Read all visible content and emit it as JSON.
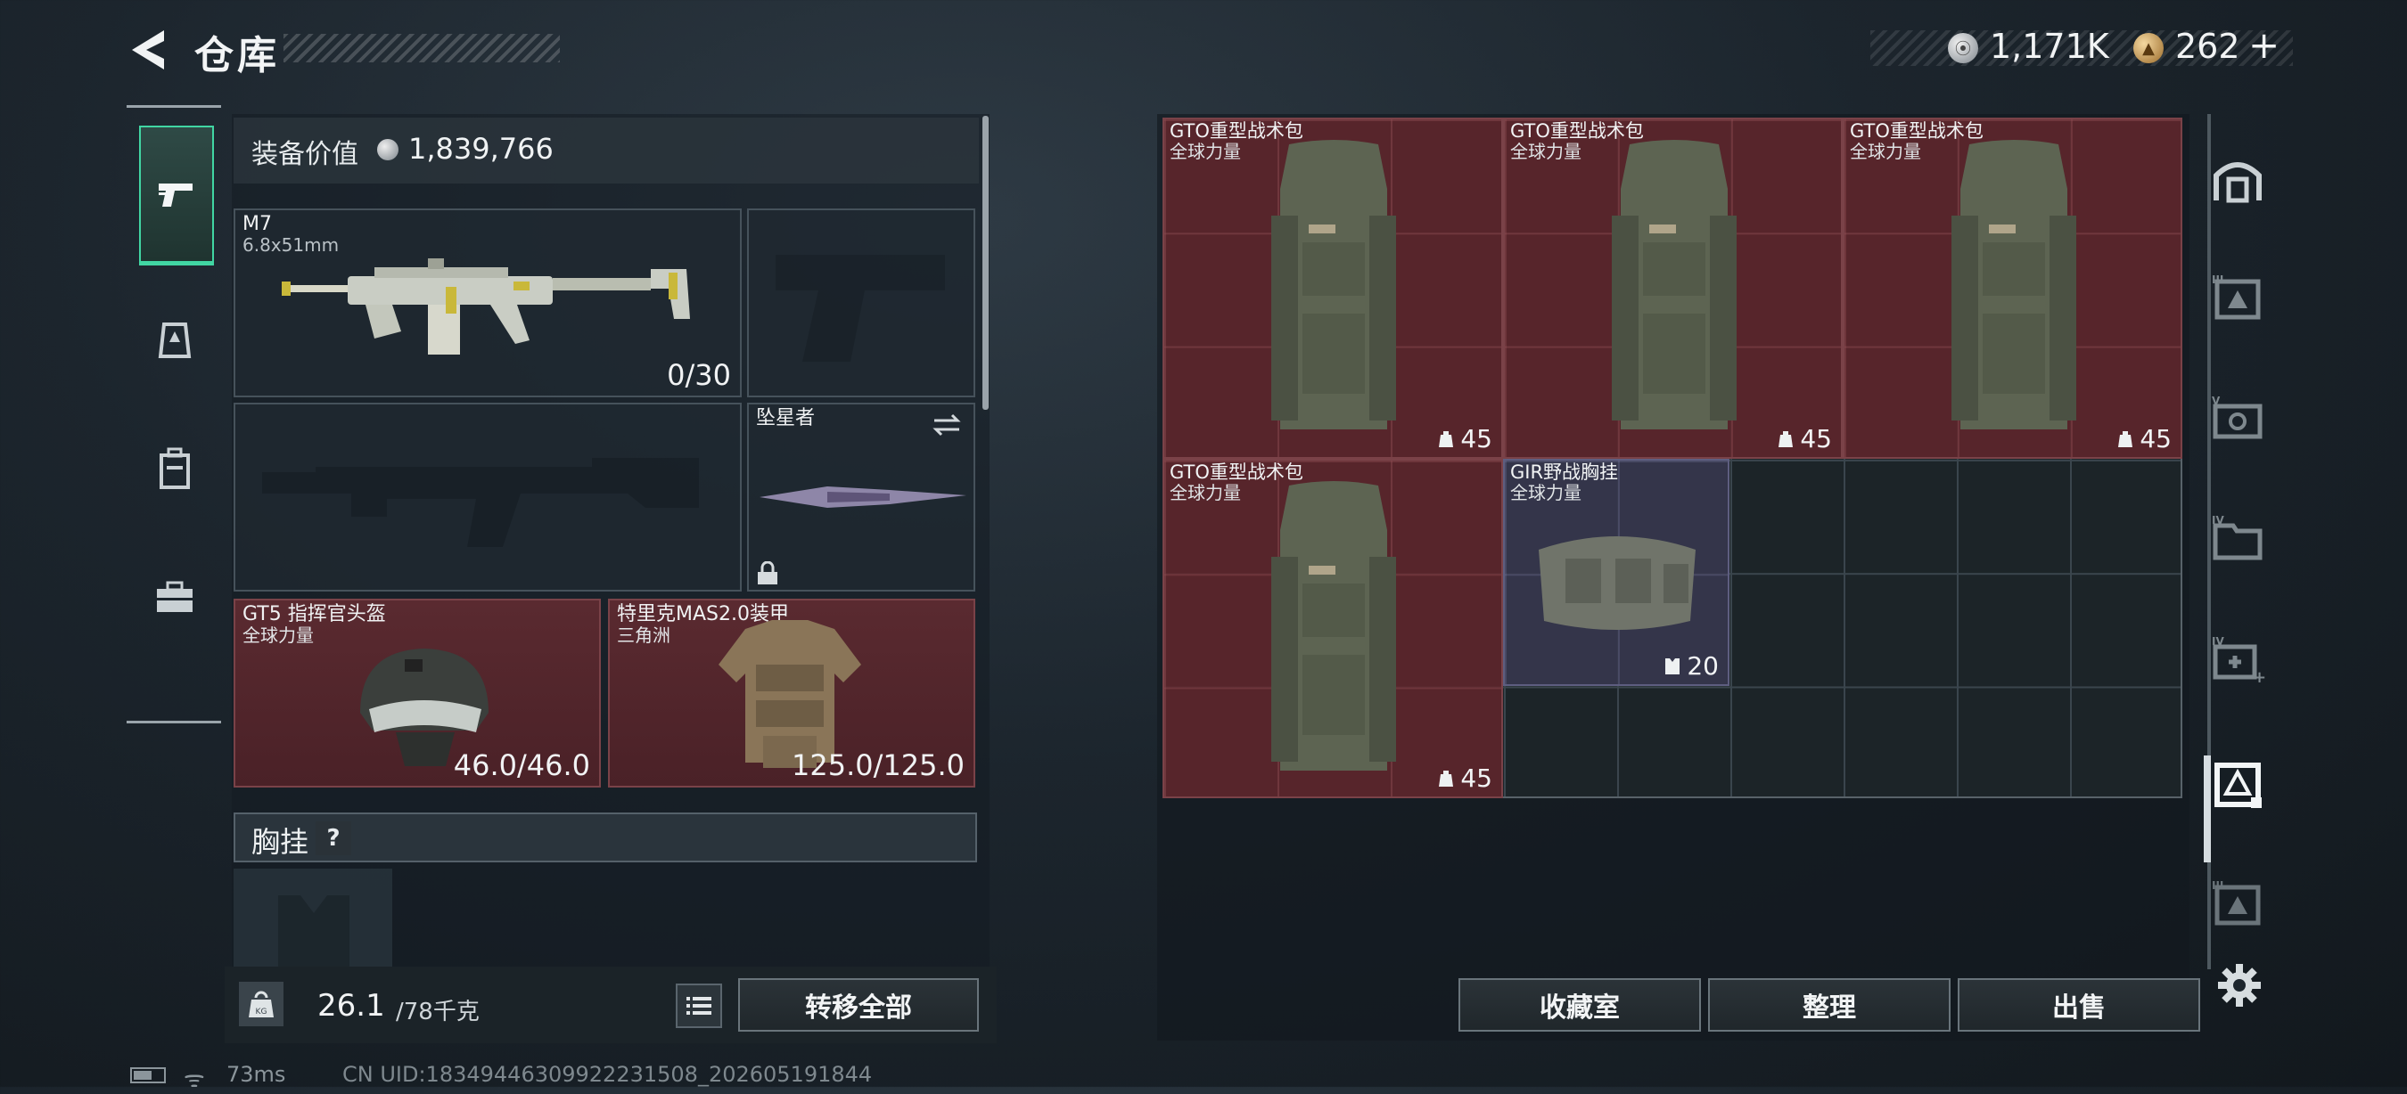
{
  "header": {
    "title": "仓库",
    "currency_silver": "1,171K",
    "currency_gold": "262",
    "gold_plus": "+"
  },
  "equipment": {
    "value_label": "装备价值",
    "value": "1,839,766",
    "primary_weapon": {
      "name": "M7",
      "caliber": "6.8x51mm",
      "ammo": "0/30"
    },
    "melee": {
      "name": "坠星者"
    },
    "helmet": {
      "name": "GT5 指挥官头盔",
      "faction": "全球力量",
      "durability": "46.0/46.0"
    },
    "armor": {
      "name": "特里克MAS2.0装甲",
      "faction": "三角洲",
      "durability": "125.0/125.0"
    },
    "chest_rig_label": "胸挂",
    "help": "?"
  },
  "bottom": {
    "weight_current": "26.1",
    "weight_max": "/78千克",
    "transfer_all": "转移全部"
  },
  "storage": {
    "items": [
      {
        "name": "GTO重型战术包",
        "faction": "全球力量",
        "capacity": "45"
      },
      {
        "name": "GTO重型战术包",
        "faction": "全球力量",
        "capacity": "45"
      },
      {
        "name": "GTO重型战术包",
        "faction": "全球力量",
        "capacity": "45"
      },
      {
        "name": "GTO重型战术包",
        "faction": "全球力量",
        "capacity": "45"
      },
      {
        "name": "GIR野战胸挂",
        "faction": "全球力量",
        "capacity": "20"
      }
    ],
    "buttons": {
      "collection": "收藏室",
      "sort": "整理",
      "sell": "出售"
    }
  },
  "status": {
    "ping": "73ms",
    "uid": "CN UID:18349446309922231508_202605191844"
  },
  "colors": {
    "accent_green": "#41d6a3",
    "item_red": "#62262c",
    "item_purple": "#37374e"
  }
}
